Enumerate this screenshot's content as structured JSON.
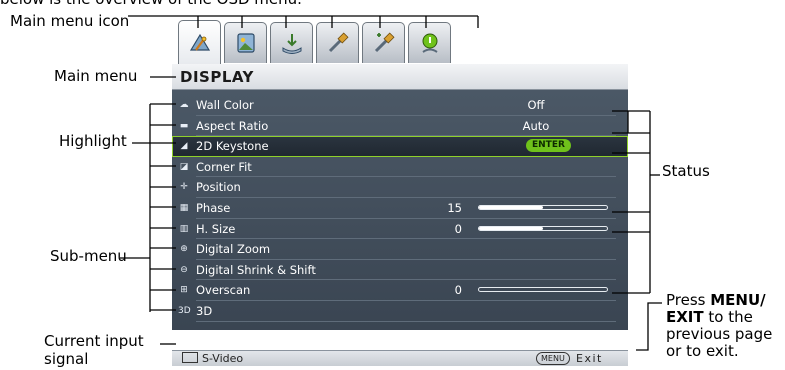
{
  "top_caption": "below is the overview of the OSD menu.",
  "callouts": {
    "main_menu_icon": "Main menu icon",
    "main_menu": "Main menu",
    "highlight": "Highlight",
    "sub_menu": "Sub-menu",
    "current_input_line1": "Current input",
    "current_input_line2": "signal",
    "status": "Status",
    "press_line1_prefix": "Press ",
    "press_line1_bold": "MENU/",
    "press_line2_bold": "EXIT",
    "press_line2_rest": " to the",
    "press_line3": "previous page",
    "press_line4": "or to exit."
  },
  "osd": {
    "tabs": [
      {
        "icon": "display-tab-icon",
        "active": true
      },
      {
        "icon": "picture-tab-icon",
        "active": false
      },
      {
        "icon": "source-tab-icon",
        "active": false
      },
      {
        "icon": "system-setup-basic-tab-icon",
        "active": false
      },
      {
        "icon": "system-setup-advanced-tab-icon",
        "active": false
      },
      {
        "icon": "information-tab-icon",
        "active": false
      }
    ],
    "menu_title": "DISPLAY",
    "items": [
      {
        "icon": "wall-color-icon",
        "glyph": "☁",
        "label": "Wall Color",
        "value": "Off"
      },
      {
        "icon": "aspect-ratio-icon",
        "glyph": "▬",
        "label": "Aspect Ratio",
        "value": "Auto"
      },
      {
        "icon": "keystone-icon",
        "glyph": "◢",
        "label": "2D Keystone",
        "enter": "ENTER",
        "highlighted": true
      },
      {
        "icon": "corner-fit-icon",
        "glyph": "◪",
        "label": "Corner Fit"
      },
      {
        "icon": "position-icon",
        "glyph": "✛",
        "label": "Position"
      },
      {
        "icon": "phase-icon",
        "glyph": "▦",
        "label": "Phase",
        "number": "15",
        "level": 0.5
      },
      {
        "icon": "h-size-icon",
        "glyph": "▥",
        "label": "H. Size",
        "number": "0",
        "level": 0.5
      },
      {
        "icon": "digital-zoom-icon",
        "glyph": "⊕",
        "label": "Digital Zoom"
      },
      {
        "icon": "digital-shrink-shift-icon",
        "glyph": "⊖",
        "label": "Digital Shrink & Shift"
      },
      {
        "icon": "overscan-icon",
        "glyph": "⊞",
        "label": "Overscan",
        "number": "0",
        "level": 0.0
      },
      {
        "icon": "3d-icon",
        "glyph": "3D",
        "label": "3D"
      }
    ],
    "footer": {
      "source": "S-Video",
      "menu_key": "MENU",
      "exit": "Exit"
    }
  },
  "colors": {
    "highlight_border": "#8fd12a",
    "enter_pill": "#6fc21b",
    "menu_bg": "#46525f"
  }
}
